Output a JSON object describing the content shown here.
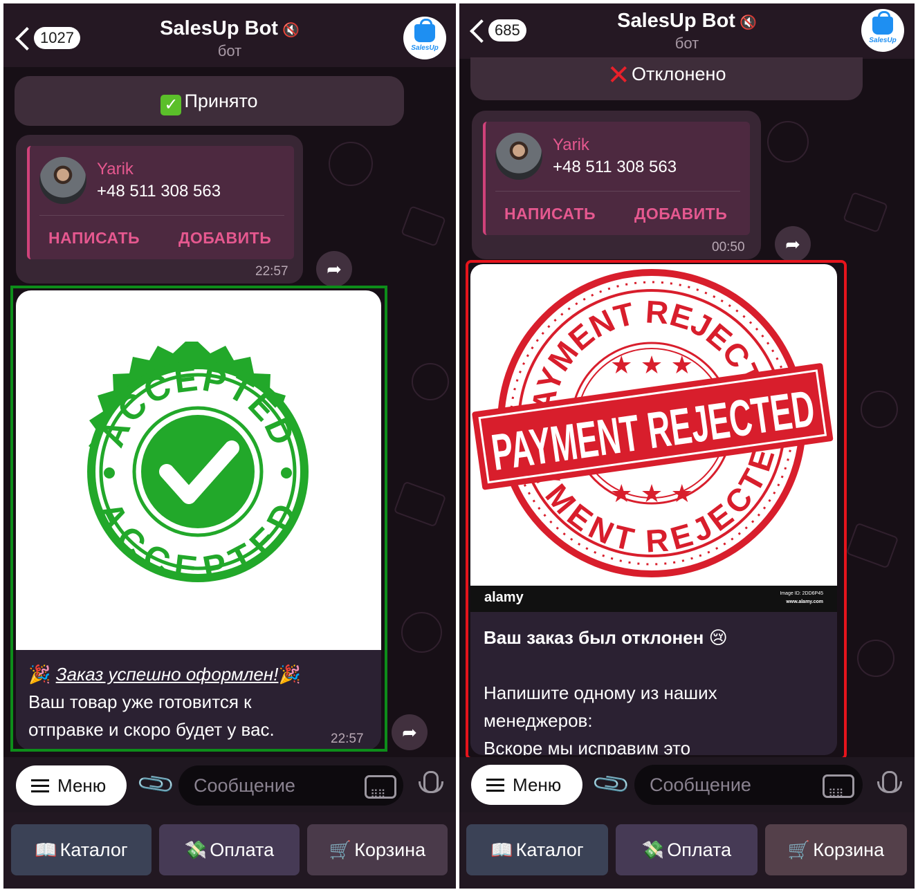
{
  "left_screen": {
    "header": {
      "back_badge": "1027",
      "title": "SalesUp Bot",
      "subtitle": "бот",
      "logo_text": "SalesUp"
    },
    "status_text": "Принято",
    "contact": {
      "name": "Yarik",
      "phone": "+48 511 308 563",
      "write_label": "НАПИСАТЬ",
      "add_label": "ДОБАВИТЬ",
      "time": "22:57"
    },
    "image_message": {
      "stamp_top_text": "ACCEPTED",
      "stamp_bottom_text": "ACCEPTED",
      "caption_title": "Заказ успешно оформлен!",
      "caption_line1": "Ваш товар уже готовится к",
      "caption_line2": "отправке и скоро будет у вас.",
      "time": "22:57"
    },
    "input": {
      "menu_label": "Меню",
      "placeholder": "Сообщение"
    },
    "keyboard": [
      {
        "icon": "📖",
        "label": "Каталог"
      },
      {
        "icon": "💸",
        "label": "Оплата"
      },
      {
        "icon": "🛒",
        "label": "Корзина"
      }
    ]
  },
  "right_screen": {
    "header": {
      "back_badge": "685",
      "title": "SalesUp Bot",
      "subtitle": "бот",
      "logo_text": "SalesUp"
    },
    "status_text": "Отклонено",
    "contact": {
      "name": "Yarik",
      "phone": "+48 511 308 563",
      "write_label": "НАПИСАТЬ",
      "add_label": "ДОБАВИТЬ",
      "time": "00:50"
    },
    "image_message": {
      "stamp_ring_top": "PAYMENT REJECTED",
      "stamp_banner": "PAYMENT REJECTED",
      "stamp_ring_bottom": "PAYMENT REJECTED",
      "watermark": "alamy",
      "image_id": "Image ID: 2DD6P45",
      "watermark_url": "www.alamy.com",
      "caption_title": "Ваш заказ был отклонен",
      "caption_emoji": "😢",
      "caption_line1": "Напишите одному из наших",
      "caption_line2": "менеджеров:",
      "caption_line3": "Вскоре мы исправим это"
    },
    "input": {
      "menu_label": "Меню",
      "placeholder": "Сообщение"
    },
    "keyboard": [
      {
        "icon": "📖",
        "label": "Каталог"
      },
      {
        "icon": "💸",
        "label": "Оплата"
      },
      {
        "icon": "🛒",
        "label": "Корзина"
      }
    ]
  },
  "colors": {
    "accent_pink": "#e5588f",
    "accept_green": "#22a82a",
    "reject_red": "#d81e2c",
    "highlight_green": "#0d8d1a",
    "highlight_red": "#e6141c"
  }
}
